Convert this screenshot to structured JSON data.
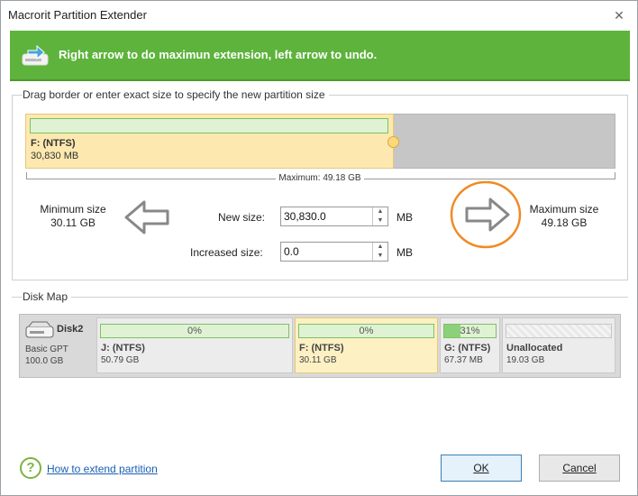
{
  "window": {
    "title": "Macrorit Partition Extender",
    "close_glyph": "✕"
  },
  "banner": {
    "text": "Right arrow to do maximun extension, left arrow to undo.",
    "bg_color": "#5db33b"
  },
  "resize_group": {
    "title": "Drag border or enter exact size to specify the new partition size",
    "partition": {
      "name": "F: (NTFS)",
      "size": "30,830 MB"
    },
    "maximum_label": "Maximum: 49.18 GB",
    "minimum": {
      "label": "Minimum size",
      "value": "30.11 GB"
    },
    "maximum": {
      "label": "Maximum size",
      "value": "49.18 GB"
    },
    "new_size": {
      "label": "New size:",
      "value": "30,830.0",
      "unit": "MB"
    },
    "increased_size": {
      "label": "Increased size:",
      "value": "0.0",
      "unit": "MB"
    },
    "left_arrow_icon": "arrow-left-icon",
    "right_arrow_icon": "arrow-right-icon",
    "highlight_color": "#f08a24"
  },
  "disk_map": {
    "title": "Disk Map",
    "disk": {
      "name": "Disk2",
      "type": "Basic GPT",
      "capacity": "100.0 GB",
      "icon": "hard-disk-icon"
    },
    "partitions": [
      {
        "name": "J: (NTFS)",
        "size": "50.79 GB",
        "usage": "0%",
        "used_fraction": 0
      },
      {
        "name": "F: (NTFS)",
        "size": "30.11 GB",
        "usage": "0%",
        "used_fraction": 0,
        "selected": true
      },
      {
        "name": "G: (NTFS)",
        "size": "67.37 MB",
        "usage": "31%",
        "used_fraction": 0.31
      },
      {
        "name": "Unallocated",
        "size": "19.03 GB",
        "usage": ""
      }
    ]
  },
  "footer": {
    "help_glyph": "?",
    "help_link": "How to extend partition",
    "ok_label": "OK",
    "cancel_label": "Cancel"
  }
}
